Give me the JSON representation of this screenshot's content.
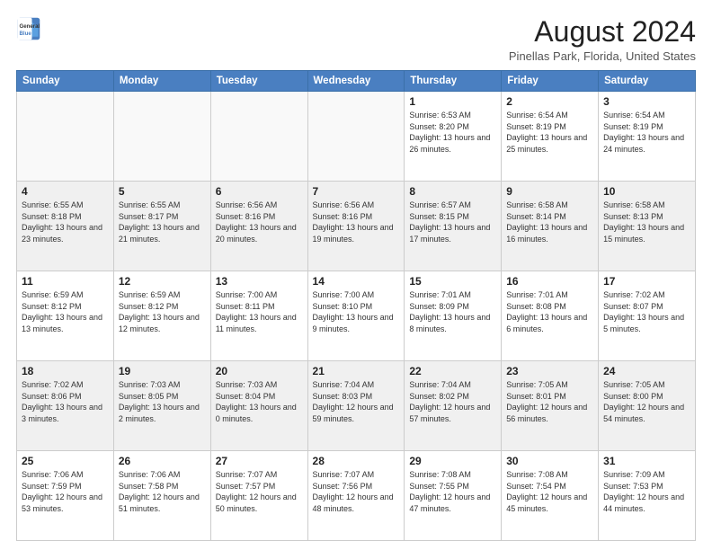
{
  "logo": {
    "line1": "General",
    "line2": "Blue"
  },
  "title": "August 2024",
  "subtitle": "Pinellas Park, Florida, United States",
  "days_of_week": [
    "Sunday",
    "Monday",
    "Tuesday",
    "Wednesday",
    "Thursday",
    "Friday",
    "Saturday"
  ],
  "weeks": [
    [
      {
        "day": "",
        "info": ""
      },
      {
        "day": "",
        "info": ""
      },
      {
        "day": "",
        "info": ""
      },
      {
        "day": "",
        "info": ""
      },
      {
        "day": "1",
        "info": "Sunrise: 6:53 AM\nSunset: 8:20 PM\nDaylight: 13 hours\nand 26 minutes."
      },
      {
        "day": "2",
        "info": "Sunrise: 6:54 AM\nSunset: 8:19 PM\nDaylight: 13 hours\nand 25 minutes."
      },
      {
        "day": "3",
        "info": "Sunrise: 6:54 AM\nSunset: 8:19 PM\nDaylight: 13 hours\nand 24 minutes."
      }
    ],
    [
      {
        "day": "4",
        "info": "Sunrise: 6:55 AM\nSunset: 8:18 PM\nDaylight: 13 hours\nand 23 minutes."
      },
      {
        "day": "5",
        "info": "Sunrise: 6:55 AM\nSunset: 8:17 PM\nDaylight: 13 hours\nand 21 minutes."
      },
      {
        "day": "6",
        "info": "Sunrise: 6:56 AM\nSunset: 8:16 PM\nDaylight: 13 hours\nand 20 minutes."
      },
      {
        "day": "7",
        "info": "Sunrise: 6:56 AM\nSunset: 8:16 PM\nDaylight: 13 hours\nand 19 minutes."
      },
      {
        "day": "8",
        "info": "Sunrise: 6:57 AM\nSunset: 8:15 PM\nDaylight: 13 hours\nand 17 minutes."
      },
      {
        "day": "9",
        "info": "Sunrise: 6:58 AM\nSunset: 8:14 PM\nDaylight: 13 hours\nand 16 minutes."
      },
      {
        "day": "10",
        "info": "Sunrise: 6:58 AM\nSunset: 8:13 PM\nDaylight: 13 hours\nand 15 minutes."
      }
    ],
    [
      {
        "day": "11",
        "info": "Sunrise: 6:59 AM\nSunset: 8:12 PM\nDaylight: 13 hours\nand 13 minutes."
      },
      {
        "day": "12",
        "info": "Sunrise: 6:59 AM\nSunset: 8:12 PM\nDaylight: 13 hours\nand 12 minutes."
      },
      {
        "day": "13",
        "info": "Sunrise: 7:00 AM\nSunset: 8:11 PM\nDaylight: 13 hours\nand 11 minutes."
      },
      {
        "day": "14",
        "info": "Sunrise: 7:00 AM\nSunset: 8:10 PM\nDaylight: 13 hours\nand 9 minutes."
      },
      {
        "day": "15",
        "info": "Sunrise: 7:01 AM\nSunset: 8:09 PM\nDaylight: 13 hours\nand 8 minutes."
      },
      {
        "day": "16",
        "info": "Sunrise: 7:01 AM\nSunset: 8:08 PM\nDaylight: 13 hours\nand 6 minutes."
      },
      {
        "day": "17",
        "info": "Sunrise: 7:02 AM\nSunset: 8:07 PM\nDaylight: 13 hours\nand 5 minutes."
      }
    ],
    [
      {
        "day": "18",
        "info": "Sunrise: 7:02 AM\nSunset: 8:06 PM\nDaylight: 13 hours\nand 3 minutes."
      },
      {
        "day": "19",
        "info": "Sunrise: 7:03 AM\nSunset: 8:05 PM\nDaylight: 13 hours\nand 2 minutes."
      },
      {
        "day": "20",
        "info": "Sunrise: 7:03 AM\nSunset: 8:04 PM\nDaylight: 13 hours\nand 0 minutes."
      },
      {
        "day": "21",
        "info": "Sunrise: 7:04 AM\nSunset: 8:03 PM\nDaylight: 12 hours\nand 59 minutes."
      },
      {
        "day": "22",
        "info": "Sunrise: 7:04 AM\nSunset: 8:02 PM\nDaylight: 12 hours\nand 57 minutes."
      },
      {
        "day": "23",
        "info": "Sunrise: 7:05 AM\nSunset: 8:01 PM\nDaylight: 12 hours\nand 56 minutes."
      },
      {
        "day": "24",
        "info": "Sunrise: 7:05 AM\nSunset: 8:00 PM\nDaylight: 12 hours\nand 54 minutes."
      }
    ],
    [
      {
        "day": "25",
        "info": "Sunrise: 7:06 AM\nSunset: 7:59 PM\nDaylight: 12 hours\nand 53 minutes."
      },
      {
        "day": "26",
        "info": "Sunrise: 7:06 AM\nSunset: 7:58 PM\nDaylight: 12 hours\nand 51 minutes."
      },
      {
        "day": "27",
        "info": "Sunrise: 7:07 AM\nSunset: 7:57 PM\nDaylight: 12 hours\nand 50 minutes."
      },
      {
        "day": "28",
        "info": "Sunrise: 7:07 AM\nSunset: 7:56 PM\nDaylight: 12 hours\nand 48 minutes."
      },
      {
        "day": "29",
        "info": "Sunrise: 7:08 AM\nSunset: 7:55 PM\nDaylight: 12 hours\nand 47 minutes."
      },
      {
        "day": "30",
        "info": "Sunrise: 7:08 AM\nSunset: 7:54 PM\nDaylight: 12 hours\nand 45 minutes."
      },
      {
        "day": "31",
        "info": "Sunrise: 7:09 AM\nSunset: 7:53 PM\nDaylight: 12 hours\nand 44 minutes."
      }
    ]
  ]
}
